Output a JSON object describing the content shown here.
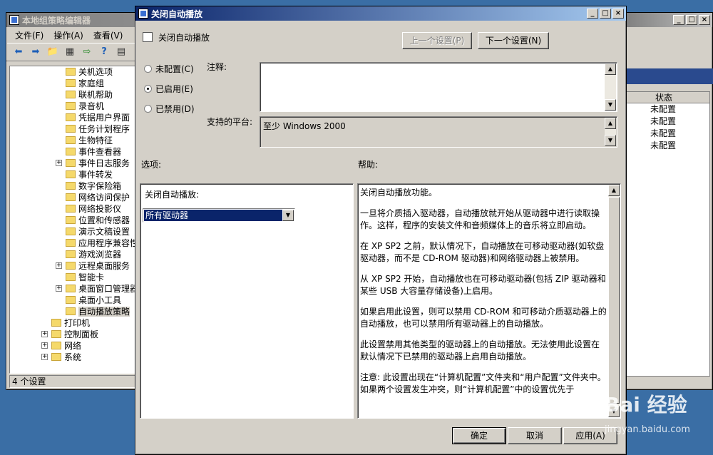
{
  "bg_editor": {
    "title": "本地组策略编辑器",
    "menu": [
      "文件(F)",
      "操作(A)",
      "查看(V)"
    ],
    "tree": [
      {
        "label": "关机选项",
        "indent": 2,
        "expand": false
      },
      {
        "label": "家庭组",
        "indent": 2,
        "expand": false
      },
      {
        "label": "联机帮助",
        "indent": 2,
        "expand": false
      },
      {
        "label": "录音机",
        "indent": 2,
        "expand": false
      },
      {
        "label": "凭据用户界面",
        "indent": 2,
        "expand": false
      },
      {
        "label": "任务计划程序",
        "indent": 2,
        "expand": false
      },
      {
        "label": "生物特征",
        "indent": 2,
        "expand": false
      },
      {
        "label": "事件查看器",
        "indent": 2,
        "expand": false
      },
      {
        "label": "事件日志服务",
        "indent": 2,
        "expand": true
      },
      {
        "label": "事件转发",
        "indent": 2,
        "expand": false
      },
      {
        "label": "数字保险箱",
        "indent": 2,
        "expand": false
      },
      {
        "label": "网络访问保护",
        "indent": 2,
        "expand": false
      },
      {
        "label": "网络投影仪",
        "indent": 2,
        "expand": false
      },
      {
        "label": "位置和传感器",
        "indent": 2,
        "expand": false
      },
      {
        "label": "演示文稿设置",
        "indent": 2,
        "expand": false
      },
      {
        "label": "应用程序兼容性",
        "indent": 2,
        "expand": false
      },
      {
        "label": "游戏浏览器",
        "indent": 2,
        "expand": false
      },
      {
        "label": "远程桌面服务",
        "indent": 2,
        "expand": true
      },
      {
        "label": "智能卡",
        "indent": 2,
        "expand": false
      },
      {
        "label": "桌面窗口管理器",
        "indent": 2,
        "expand": true
      },
      {
        "label": "桌面小工具",
        "indent": 2,
        "expand": false
      },
      {
        "label": "自动播放策略",
        "indent": 2,
        "expand": false,
        "selected": true
      },
      {
        "label": "打印机",
        "indent": 1,
        "expand": false
      },
      {
        "label": "控制面板",
        "indent": 1,
        "expand": true
      },
      {
        "label": "网络",
        "indent": 1,
        "expand": true
      },
      {
        "label": "系统",
        "indent": 1,
        "expand": true
      }
    ],
    "status": "4 个设置"
  },
  "bg_right": {
    "column": "状态",
    "rows": [
      "未配置",
      "未配置",
      "未配置",
      "未配置"
    ]
  },
  "dialog": {
    "title": "关闭自动播放",
    "heading": "关闭自动播放",
    "prev_button": "上一个设置(P)",
    "next_button": "下一个设置(N)",
    "radios": [
      {
        "label": "未配置(C)",
        "checked": false
      },
      {
        "label": "已启用(E)",
        "checked": true
      },
      {
        "label": "已禁用(D)",
        "checked": false
      }
    ],
    "comment_label": "注释:",
    "platform_label": "支持的平台:",
    "platform_value": "至少 Windows 2000",
    "options_label": "选项:",
    "help_label": "帮助:",
    "option_field_label": "关闭自动播放:",
    "option_value": "所有驱动器",
    "help_paragraphs": [
      "关闭自动播放功能。",
      "一旦将介质插入驱动器，自动播放就开始从驱动器中进行读取操作。这样，程序的安装文件和音频媒体上的音乐将立即启动。",
      "在 XP SP2 之前，默认情况下，自动播放在可移动驱动器(如软盘驱动器，而不是 CD-ROM 驱动器)和网络驱动器上被禁用。",
      "从 XP SP2 开始，自动播放也在可移动驱动器(包括 ZIP 驱动器和某些 USB 大容量存储设备)上启用。",
      "如果启用此设置，则可以禁用 CD-ROM 和可移动介质驱动器上的自动播放，也可以禁用所有驱动器上的自动播放。",
      "此设置禁用其他类型的驱动器上的自动播放。无法使用此设置在默认情况下已禁用的驱动器上启用自动播放。",
      "注意: 此设置出现在“计算机配置”文件夹和“用户配置”文件夹中。如果两个设置发生冲突，则“计算机配置”中的设置优先于"
    ],
    "ok_button": "确定",
    "cancel_button": "取消",
    "apply_button": "应用(A)"
  },
  "watermark": {
    "brand": "Bai 经验",
    "url": "jingyan.baidu.com"
  }
}
